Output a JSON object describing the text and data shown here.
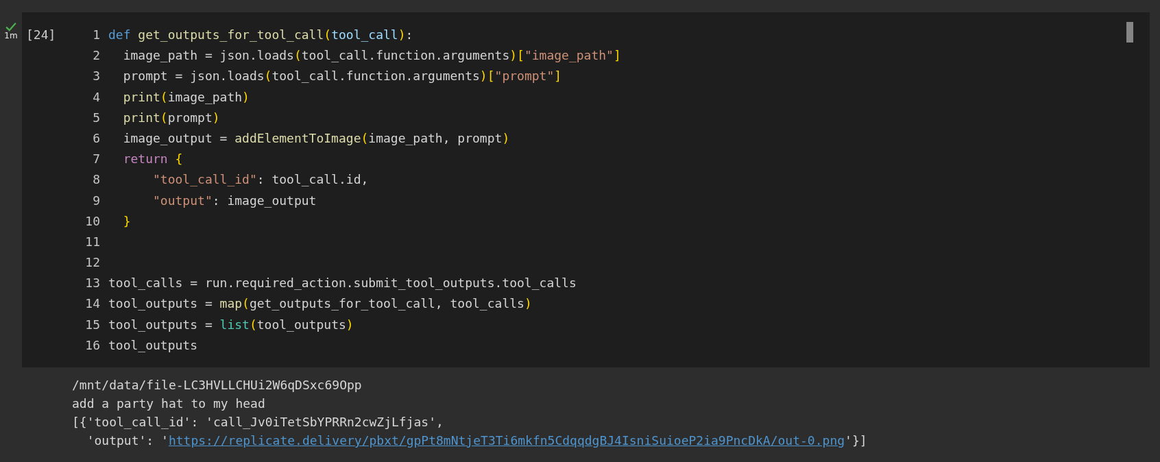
{
  "cell": {
    "succeeded": true,
    "duration": "1m",
    "execution_count": "[24]",
    "code_lines": [
      {
        "number": "1",
        "tokens": [
          {
            "kind": "keyword",
            "text": "def"
          },
          {
            "kind": "function",
            "text": " get_outputs_for_tool_call"
          },
          {
            "kind": "brace",
            "text": "("
          },
          {
            "kind": "param",
            "text": "tool_call"
          },
          {
            "kind": "brace",
            "text": ")"
          },
          {
            "kind": "plain",
            "text": ":"
          }
        ]
      },
      {
        "number": "2",
        "tokens": [
          {
            "kind": "plain",
            "text": "  image_path = json.loads"
          },
          {
            "kind": "brace",
            "text": "("
          },
          {
            "kind": "plain",
            "text": "tool_call.function.arguments"
          },
          {
            "kind": "brace",
            "text": ")["
          },
          {
            "kind": "string",
            "text": "\"image_path\""
          },
          {
            "kind": "brace",
            "text": "]"
          }
        ]
      },
      {
        "number": "3",
        "tokens": [
          {
            "kind": "plain",
            "text": "  prompt = json.loads"
          },
          {
            "kind": "brace",
            "text": "("
          },
          {
            "kind": "plain",
            "text": "tool_call.function.arguments"
          },
          {
            "kind": "brace",
            "text": ")["
          },
          {
            "kind": "string",
            "text": "\"prompt\""
          },
          {
            "kind": "brace",
            "text": "]"
          }
        ]
      },
      {
        "number": "4",
        "tokens": [
          {
            "kind": "function",
            "text": "  print"
          },
          {
            "kind": "brace",
            "text": "("
          },
          {
            "kind": "plain",
            "text": "image_path"
          },
          {
            "kind": "brace",
            "text": ")"
          }
        ]
      },
      {
        "number": "5",
        "tokens": [
          {
            "kind": "function",
            "text": "  print"
          },
          {
            "kind": "brace",
            "text": "("
          },
          {
            "kind": "plain",
            "text": "prompt"
          },
          {
            "kind": "brace",
            "text": ")"
          }
        ]
      },
      {
        "number": "6",
        "tokens": [
          {
            "kind": "plain",
            "text": "  image_output = "
          },
          {
            "kind": "function",
            "text": "addElementToImage"
          },
          {
            "kind": "brace",
            "text": "("
          },
          {
            "kind": "plain",
            "text": "image_path, prompt"
          },
          {
            "kind": "brace",
            "text": ")"
          }
        ]
      },
      {
        "number": "7",
        "tokens": [
          {
            "kind": "control",
            "text": "  return"
          },
          {
            "kind": "brace",
            "text": " {"
          }
        ]
      },
      {
        "number": "8",
        "tokens": [
          {
            "kind": "string",
            "text": "      \"tool_call_id\""
          },
          {
            "kind": "plain",
            "text": ": tool_call.id,"
          }
        ]
      },
      {
        "number": "9",
        "tokens": [
          {
            "kind": "string",
            "text": "      \"output\""
          },
          {
            "kind": "plain",
            "text": ": image_output"
          }
        ]
      },
      {
        "number": "10",
        "tokens": [
          {
            "kind": "brace",
            "text": "  }"
          }
        ]
      },
      {
        "number": "11"
      },
      {
        "number": "12"
      },
      {
        "number": "13",
        "tokens": [
          {
            "kind": "plain",
            "text": "tool_calls = run.required_action.submit_tool_outputs.tool_calls"
          }
        ]
      },
      {
        "number": "14",
        "tokens": [
          {
            "kind": "plain",
            "text": "tool_outputs = "
          },
          {
            "kind": "function",
            "text": "map"
          },
          {
            "kind": "brace",
            "text": "("
          },
          {
            "kind": "plain",
            "text": "get_outputs_for_tool_call, tool_calls"
          },
          {
            "kind": "brace",
            "text": ")"
          }
        ]
      },
      {
        "number": "15",
        "tokens": [
          {
            "kind": "plain",
            "text": "tool_outputs = "
          },
          {
            "kind": "builtin",
            "text": "list"
          },
          {
            "kind": "brace",
            "text": "("
          },
          {
            "kind": "plain",
            "text": "tool_outputs"
          },
          {
            "kind": "brace",
            "text": ")"
          }
        ]
      },
      {
        "number": "16",
        "tokens": [
          {
            "kind": "plain",
            "text": "tool_outputs"
          }
        ]
      }
    ],
    "output_lines": [
      {
        "parts": [
          {
            "kind": "text",
            "text": "/mnt/data/file-LC3HVLLCHUi2W6qDSxc69Opp"
          }
        ]
      },
      {
        "parts": [
          {
            "kind": "text",
            "text": "add a party hat to my head"
          }
        ]
      },
      {
        "parts": [
          {
            "kind": "text",
            "text": "[{'tool_call_id': 'call_Jv0iTetSbYPRRn2cwZjLfjas',"
          }
        ]
      },
      {
        "parts": [
          {
            "kind": "text",
            "text": "  'output': '"
          },
          {
            "kind": "link",
            "text": "https://replicate.delivery/pbxt/gpPt8mNtjeT3Ti6mkfn5CdqqdgBJ4IsniSuioeP2ia9PncDkA/out-0.png"
          },
          {
            "kind": "text",
            "text": "'}]"
          }
        ]
      }
    ]
  }
}
